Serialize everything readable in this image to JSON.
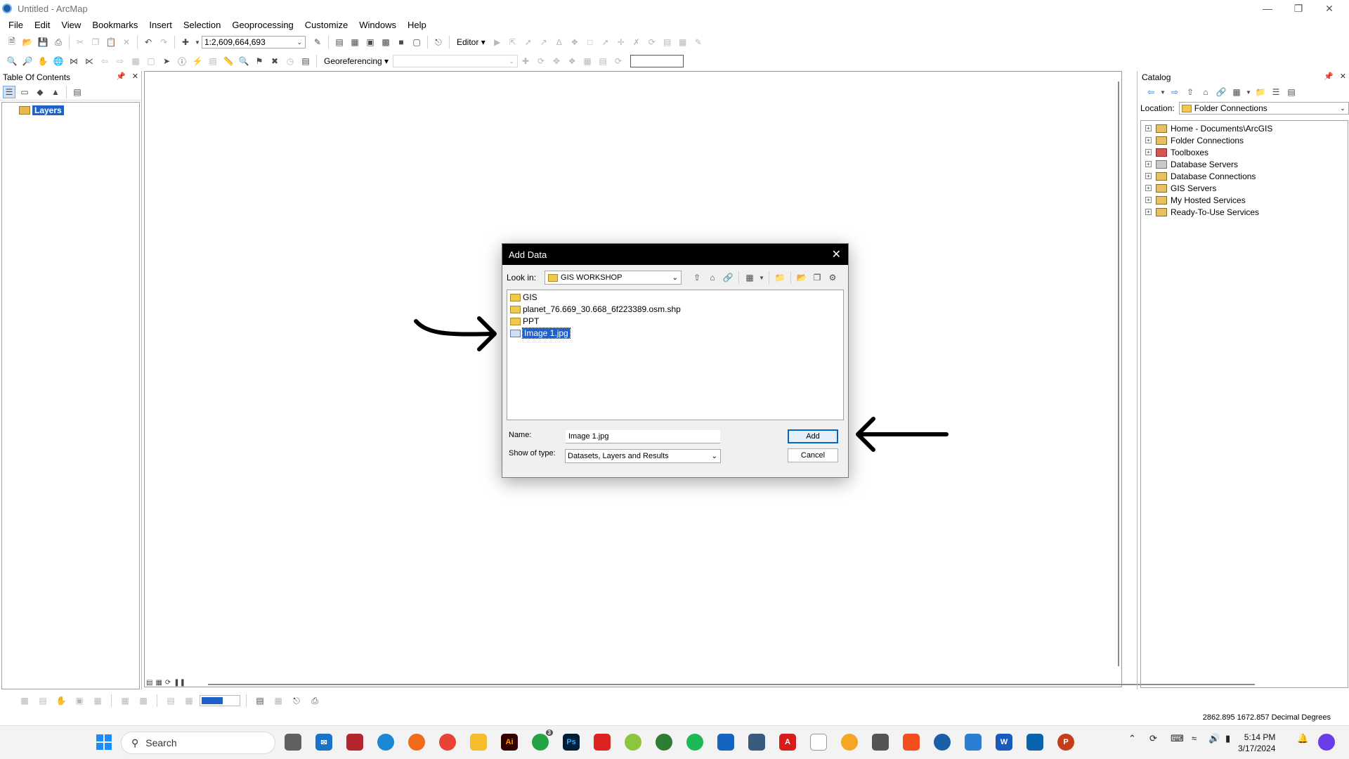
{
  "window": {
    "title": "Untitled - ArcMap",
    "controls": [
      "minimize",
      "restore",
      "close"
    ]
  },
  "menu": [
    "File",
    "Edit",
    "View",
    "Bookmarks",
    "Insert",
    "Selection",
    "Geoprocessing",
    "Customize",
    "Windows",
    "Help"
  ],
  "toolbar": {
    "scale": "1:2,609,664,693",
    "editor_label": "Editor",
    "georeferencing_label": "Georeferencing"
  },
  "toc": {
    "title": "Table Of Contents",
    "root_layer": "Layers"
  },
  "catalog": {
    "title": "Catalog",
    "location_label": "Location:",
    "location_value": "Folder Connections",
    "items": [
      "Home - Documents\\ArcGIS",
      "Folder Connections",
      "Toolboxes",
      "Database Servers",
      "Database Connections",
      "GIS Servers",
      "My Hosted Services",
      "Ready-To-Use Services"
    ]
  },
  "dialog": {
    "title": "Add Data",
    "look_in_label": "Look in:",
    "look_in_value": "GIS WORKSHOP",
    "files": [
      {
        "name": "GIS",
        "kind": "folder"
      },
      {
        "name": "planet_76.669_30.668_6f223389.osm.shp",
        "kind": "folder"
      },
      {
        "name": "PPT",
        "kind": "folder"
      },
      {
        "name": "Image 1.jpg",
        "kind": "raster",
        "selected": true
      }
    ],
    "name_label": "Name:",
    "name_value": "Image 1.jpg",
    "type_label": "Show of type:",
    "type_value": "Datasets, Layers and Results",
    "add_label": "Add",
    "cancel_label": "Cancel"
  },
  "status": {
    "coordinates": "2862.895  1672.857 Decimal Degrees"
  },
  "taskbar": {
    "search_placeholder": "Search",
    "time": "5:14 PM",
    "date": "3/17/2024",
    "whatsapp_badge": "3"
  },
  "colors": {
    "selection": "#1e62c9",
    "dialog_title_bg": "#000000",
    "accent_button": "#0067c0"
  }
}
